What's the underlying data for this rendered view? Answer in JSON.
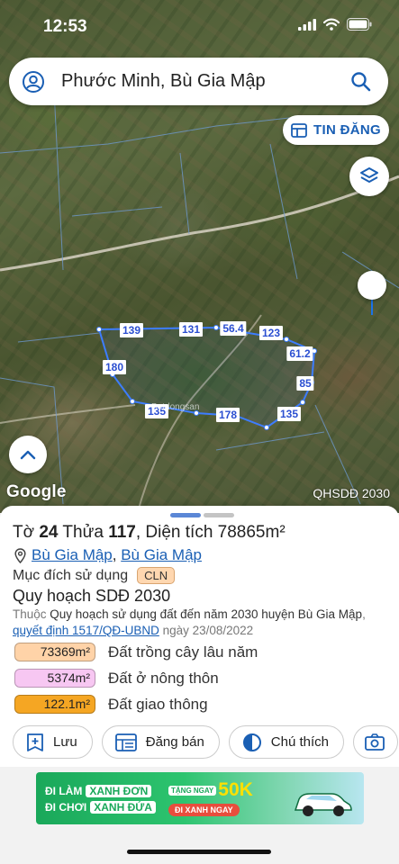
{
  "status_bar": {
    "time": "12:53"
  },
  "search": {
    "text": "Phước Minh, Bù Gia Mập"
  },
  "map": {
    "tin_dang_label": "TIN ĐĂNG",
    "google_label": "Google",
    "layer_label": "QHSDĐ 2030",
    "watermark": "Batdongsan",
    "edge_labels": [
      "139",
      "131",
      "56.4",
      "123",
      "61.2",
      "85",
      "135",
      "178",
      "135",
      "180"
    ]
  },
  "parcel": {
    "title_to_prefix": "Tờ ",
    "title_to_num": "24",
    "title_thua_prefix": " Thửa ",
    "title_thua_num": "117",
    "title_area": ", Diện tích 78865m²",
    "location_1": "Bù Gia Mập",
    "location_sep": ", ",
    "location_2": "Bù Gia Mập",
    "purpose_label": "Mục đích sử dụng",
    "purpose_code": "CLN",
    "plan_title": "Quy hoạch SDĐ 2030",
    "plan_desc_prefix": "Thuộc ",
    "plan_desc_main": "Quy hoạch sử dụng đất đến năm 2030 huyện Bù Gia Mập",
    "plan_desc_sep": ", ",
    "plan_decision": "quyết định 1517/QĐ-UBND",
    "plan_date": " ngày 23/08/2022",
    "areas": [
      {
        "value": "73369m²",
        "label": "Đất trồng cây lâu năm",
        "color": "#ffd3a8"
      },
      {
        "value": "5374m²",
        "label": "Đất ở nông thôn",
        "color": "#f7c7f2"
      },
      {
        "value": "122.1m²",
        "label": "Đất giao thông",
        "color": "#f5a623"
      }
    ]
  },
  "actions": {
    "save": "Lưu",
    "sell": "Đăng bán",
    "legend": "Chú thích"
  },
  "banner": {
    "line1_a": "ĐI LÀM",
    "line1_b": "XANH ĐƠN",
    "line2_a": "ĐI CHƠI",
    "line2_b": "XANH ĐỨA",
    "tang": "TẶNG NGAY",
    "amount": "50K",
    "cta": "ĐI XANH NGAY"
  }
}
